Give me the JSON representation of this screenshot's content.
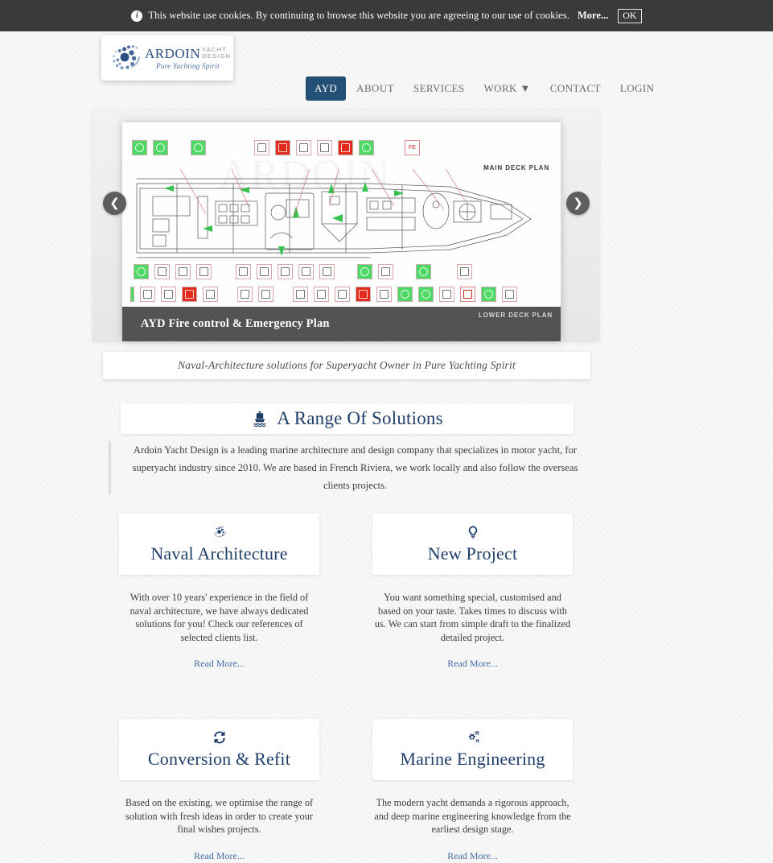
{
  "cookie": {
    "icon": "info-icon",
    "message": "This website use cookies. By continuing to browse this website you are agreeing to our use of cookies.",
    "more_label": "More...",
    "ok_label": "OK",
    "bg_color": "#3a3a3a"
  },
  "header": {
    "logo": {
      "brand": "ARDOIN",
      "sub_line1": "YACHT",
      "sub_line2": "DESIGN",
      "tagline": "Pure Yachting Spirit",
      "brand_color": "#2c4f80",
      "sub_color": "#8d9199"
    },
    "nav": [
      {
        "label": "AYD",
        "active": true
      },
      {
        "label": "ABOUT",
        "active": false
      },
      {
        "label": "SERVICES",
        "active": false
      },
      {
        "label": "WORK ▼",
        "active": false
      },
      {
        "label": "CONTACT",
        "active": false
      },
      {
        "label": "LOGIN",
        "active": false
      }
    ],
    "active_color": "#245076"
  },
  "carousel": {
    "caption": "AYD Fire control & Emergency Plan",
    "watermark": "ARDOIN",
    "main_deck_label": "MAIN DECK PLAN",
    "lower_deck_label": "LOWER DECK PLAN",
    "fe_label": "FE",
    "prev_icon": "chevron-left-icon",
    "next_icon": "chevron-right-icon",
    "prev_glyph": "❮",
    "next_glyph": "❯"
  },
  "tagline": {
    "text": "Naval-Architecture solutions for Superyacht Owner in Pure Yachting Spirit"
  },
  "section": {
    "icon": "ship-icon",
    "title": "A Range Of Solutions",
    "title_color": "#1f3f6b",
    "intro": "Ardoin Yacht Design is a leading marine architecture and design company that specializes in motor yacht, for superyacht industry since 2010. We are based in French Riviera, we work locally and also follow the overseas clients projects."
  },
  "cards": [
    {
      "icon": "spiral-logo-icon",
      "title": "Naval Architecture",
      "desc": "With over 10 years' experience in the field of naval architecture, we have always dedicated solutions for you! Check our references of selected clients list.",
      "more": "Read More..."
    },
    {
      "icon": "lightbulb-icon",
      "title": "New Project",
      "desc": "You want something special, customised and based on your taste. Takes times to discuss with us. We can start from simple draft to the finalized detailed project.",
      "more": "Read More..."
    },
    {
      "icon": "refresh-cycle-icon",
      "title": "Conversion & Refit",
      "desc": "Based on the existing, we optimise the range of solution with fresh ideas in order to create your final wishes projects.",
      "more": "Read More..."
    },
    {
      "icon": "gears-icon",
      "title": "Marine Engineering",
      "desc": "The modern yacht demands a rigorous approach, and deep marine engineering knowledge from the earliest design stage.",
      "more": "Read More..."
    }
  ]
}
